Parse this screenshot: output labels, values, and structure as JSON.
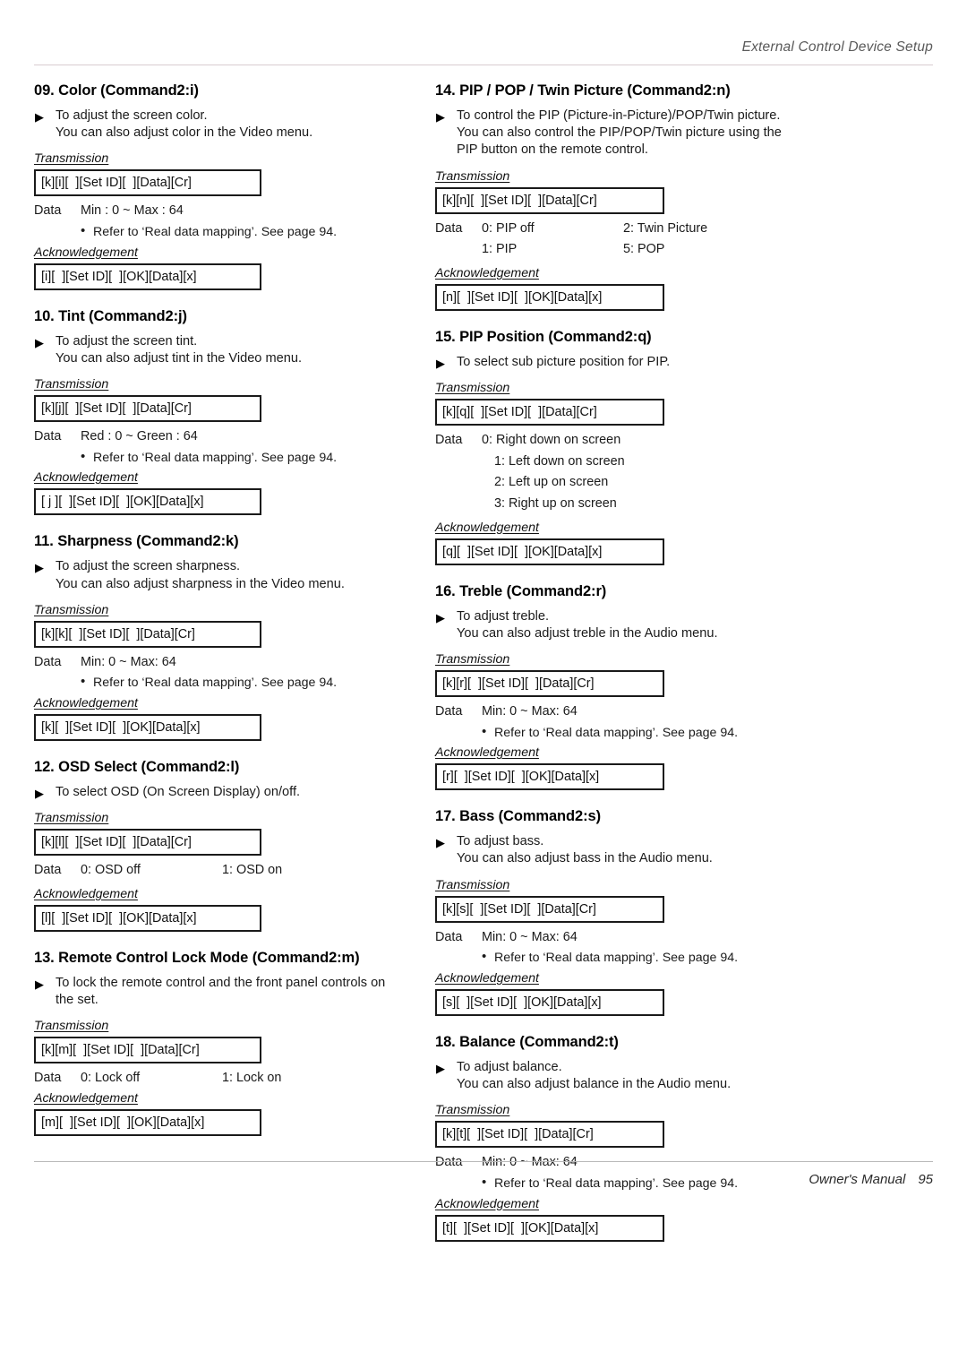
{
  "header": {
    "running_head": "External Control Device Setup"
  },
  "footer": {
    "manual_label": "Owner's Manual",
    "page_number": "95"
  },
  "glyphs": {
    "triangle": "▶",
    "bullet": "•"
  },
  "labels": {
    "transmission": "Transmission",
    "acknowledgement": "Acknowledgement",
    "data": "Data"
  },
  "left_column": [
    {
      "title": "09. Color (Command2:i)",
      "desc_line1": "To adjust the screen color.",
      "desc_line2": "You can also adjust color in the Video menu.",
      "transmission": "[k][i][  ][Set ID][  ][Data][Cr]",
      "data_value": "Min : 0 ~ Max : 64",
      "refer": "Refer to ‘Real data mapping’. See page 94.",
      "acknowledgement": "[i][  ][Set ID][  ][OK][Data][x]"
    },
    {
      "title": "10. Tint (Command2:j)",
      "desc_line1": "To adjust the screen tint.",
      "desc_line2": "You can also adjust tint in the Video menu.",
      "transmission": "[k][j][  ][Set ID][  ][Data][Cr]",
      "data_value": "Red : 0 ~ Green : 64",
      "refer": "Refer to ‘Real data mapping’. See page 94.",
      "acknowledgement": "[ j ][  ][Set ID][  ][OK][Data][x]"
    },
    {
      "title": "11. Sharpness (Command2:k)",
      "desc_line1": "To adjust the screen sharpness.",
      "desc_line2": "You can also adjust sharpness in the Video menu.",
      "transmission": "[k][k][  ][Set ID][  ][Data][Cr]",
      "data_value": "Min: 0 ~ Max: 64",
      "refer": "Refer to ‘Real data mapping’. See page 94.",
      "acknowledgement": "[k][  ][Set ID][  ][OK][Data][x]"
    },
    {
      "title": "12. OSD Select (Command2:l)",
      "desc_line1": "To select OSD (On Screen Display) on/off.",
      "desc_line2": "",
      "transmission": "[k][l][  ][Set ID][  ][Data][Cr]",
      "data_value": "0: OSD off",
      "data_value2": "1: OSD on",
      "acknowledgement": "[l][  ][Set ID][  ][OK][Data][x]"
    },
    {
      "title": "13. Remote Control Lock Mode (Command2:m)",
      "desc_line1": "To lock the remote control and the front panel controls on",
      "desc_line2": "the set.",
      "transmission": "[k][m][  ][Set ID][  ][Data][Cr]",
      "data_value": "0: Lock off",
      "data_value2": "1: Lock on",
      "acknowledgement": "[m][  ][Set ID][  ][OK][Data][x]"
    }
  ],
  "right_column": [
    {
      "title": "14. PIP / POP / Twin Picture (Command2:n)",
      "desc_line1": "To control the PIP (Picture-in-Picture)/POP/Twin picture.",
      "desc_line2": "You can also control the PIP/POP/Twin picture using the",
      "desc_line3": "PIP button on the remote control.",
      "transmission": "[k][n][  ][Set ID][  ][Data][Cr]",
      "data_rows": [
        {
          "left": "0: PIP off",
          "right": "2: Twin Picture"
        },
        {
          "left": "1: PIP",
          "right": "5: POP"
        }
      ],
      "acknowledgement": "[n][  ][Set ID][  ][OK][Data][x]"
    },
    {
      "title": "15. PIP Position (Command2:q)",
      "desc_line1": "To select sub picture position for PIP.",
      "desc_line2": "",
      "transmission": "[k][q][  ][Set ID][  ][Data][Cr]",
      "data_list": [
        "0: Right down on screen",
        "1: Left down on screen",
        "2: Left up on screen",
        "3: Right up on screen"
      ],
      "acknowledgement": "[q][  ][Set ID][  ][OK][Data][x]"
    },
    {
      "title": "16. Treble (Command2:r)",
      "desc_line1": "To adjust treble.",
      "desc_line2": "You can also adjust treble in the Audio menu.",
      "transmission": "[k][r][  ][Set ID][  ][Data][Cr]",
      "data_value": "Min: 0 ~ Max: 64",
      "refer": "Refer to ‘Real data mapping’. See page 94.",
      "acknowledgement": "[r][  ][Set ID][  ][OK][Data][x]"
    },
    {
      "title": "17. Bass (Command2:s)",
      "desc_line1": "To adjust bass.",
      "desc_line2": "You can also adjust bass in the Audio menu.",
      "transmission": "[k][s][  ][Set ID][  ][Data][Cr]",
      "data_value": "Min: 0 ~ Max: 64",
      "refer": "Refer to ‘Real data mapping’. See page 94.",
      "acknowledgement": "[s][  ][Set ID][  ][OK][Data][x]"
    },
    {
      "title": "18. Balance (Command2:t)",
      "desc_line1": "To adjust balance.",
      "desc_line2": "You can also adjust balance in the Audio menu.",
      "transmission": "[k][t][  ][Set ID][  ][Data][Cr]",
      "data_value": "Min: 0 ~ Max: 64",
      "refer": "Refer to ‘Real data mapping’. See page 94.",
      "acknowledgement": "[t][  ][Set ID][  ][OK][Data][x]"
    }
  ]
}
